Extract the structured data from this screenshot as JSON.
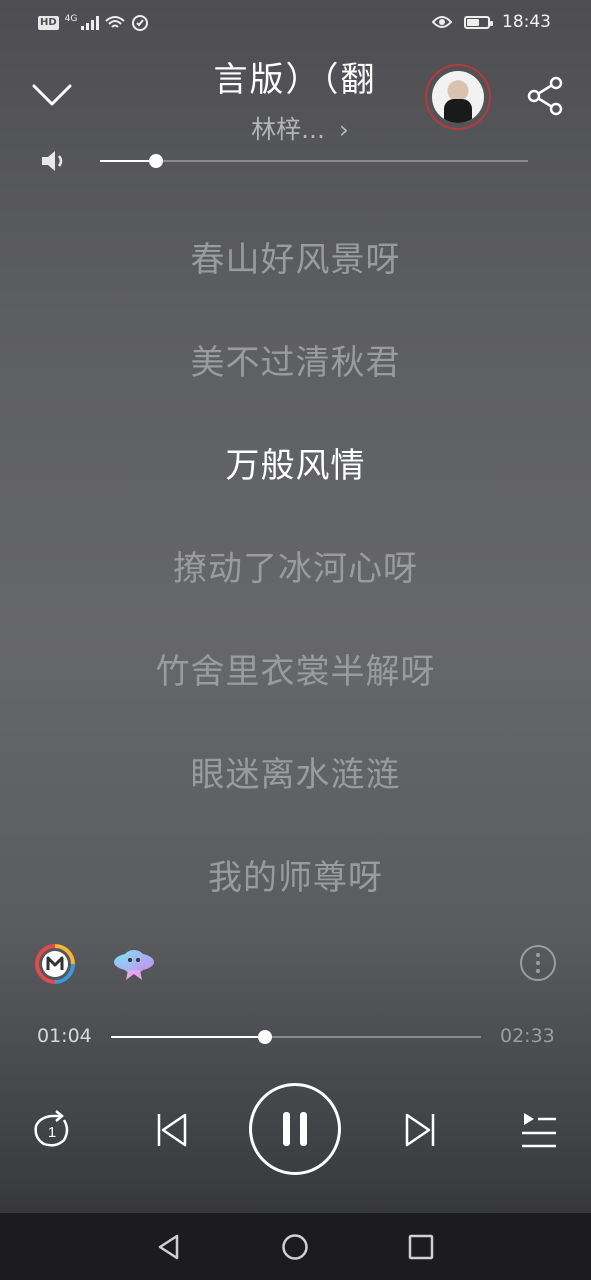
{
  "status_bar": {
    "hd": "HD",
    "network": "4G",
    "time": "18:43",
    "icons": [
      "signal-icon",
      "wifi-icon",
      "data-saver-icon",
      "eye-comfort-icon",
      "battery-icon"
    ]
  },
  "header": {
    "title": "言版）（翻",
    "artist": "林梓...",
    "artist_chevron": "›"
  },
  "volume": {
    "level_fraction": 0.13
  },
  "lyrics": [
    {
      "text": "春山好风景呀",
      "active": false
    },
    {
      "text": "美不过清秋君",
      "active": false
    },
    {
      "text": "万般风情",
      "active": true
    },
    {
      "text": "撩动了冰河心呀",
      "active": false
    },
    {
      "text": "竹舍里衣裳半解呀",
      "active": false
    },
    {
      "text": "眼迷离水涟涟",
      "active": false
    },
    {
      "text": "我的师尊呀",
      "active": false
    }
  ],
  "progress": {
    "current": "01:04",
    "total": "02:33",
    "fraction": 0.416
  },
  "controls": {
    "repeat_badge": "1",
    "state": "playing"
  },
  "colors": {
    "active_lyric": "#ffffff",
    "inactive_lyric": "#9a9b9e",
    "avatar_ring": "#b33b3b"
  }
}
